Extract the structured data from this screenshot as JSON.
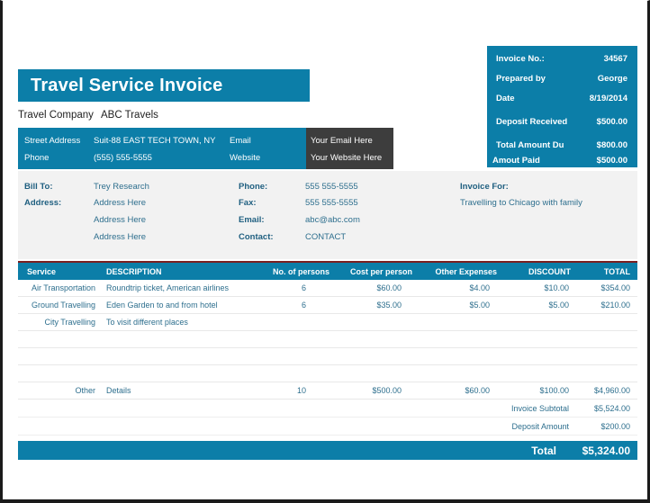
{
  "document": {
    "title": "Travel Service Invoice"
  },
  "company": {
    "label": "Travel Company",
    "name": "ABC Travels"
  },
  "address_strip": {
    "street_label": "Street Address",
    "street_value": "Suit-88 EAST TECH TOWN, NY",
    "phone_label": "Phone",
    "phone_value": "(555) 555-5555",
    "email_label": "Email",
    "email_value": "Your Email Here",
    "website_label": "Website",
    "website_value": "Your Website Here"
  },
  "invoice_box": {
    "rows": [
      {
        "key": "Invoice No.:",
        "value": "34567"
      },
      {
        "key": "Prepared by",
        "value": "George"
      },
      {
        "key": "Date",
        "value": "8/19/2014"
      },
      {
        "key": "Deposit Received",
        "value": "$500.00"
      },
      {
        "key": "Total Amount Du",
        "value": "$800.00"
      },
      {
        "key": "Amout Paid",
        "value": "$500.00"
      }
    ]
  },
  "bill_to": {
    "bill_to_label": "Bill To:",
    "bill_to_value": "Trey Research",
    "address_label": "Address:",
    "address_line1": "Address Here",
    "address_line2": "Address Here",
    "address_line3": "Address Here",
    "phone_label": "Phone:",
    "phone_value": "555 555-5555",
    "fax_label": "Fax:",
    "fax_value": "555 555-5555",
    "email_label": "Email:",
    "email_value": "abc@abc.com",
    "contact_label": "Contact:",
    "contact_value": "CONTACT",
    "invoice_for_label": "Invoice For:",
    "invoice_for_value": "Travelling to Chicago with family"
  },
  "items_table": {
    "headers": {
      "service": "Service",
      "description": "DESCRIPTION",
      "persons": "No. of persons",
      "cost": "Cost per person",
      "other": "Other Expenses",
      "discount": "DISCOUNT",
      "total": "TOTAL"
    },
    "rows": [
      {
        "service": "Air Transportation",
        "description": "Roundtrip ticket, American airlines",
        "persons": "6",
        "cost": "$60.00",
        "other": "$4.00",
        "discount": "$10.00",
        "total": "$354.00"
      },
      {
        "service": "Ground Travelling",
        "description": "Eden Garden to and from hotel",
        "persons": "6",
        "cost": "$35.00",
        "other": "$5.00",
        "discount": "$5.00",
        "total": "$210.00"
      },
      {
        "service": "City Travelling",
        "description": "To visit different places",
        "persons": "",
        "cost": "",
        "other": "",
        "discount": "",
        "total": ""
      },
      {
        "service": "",
        "description": "",
        "persons": "",
        "cost": "",
        "other": "",
        "discount": "",
        "total": ""
      },
      {
        "service": "",
        "description": "",
        "persons": "",
        "cost": "",
        "other": "",
        "discount": "",
        "total": ""
      },
      {
        "service": "",
        "description": "",
        "persons": "",
        "cost": "",
        "other": "",
        "discount": "",
        "total": ""
      },
      {
        "service": "Other",
        "description": "Details",
        "persons": "10",
        "cost": "$500.00",
        "other": "$60.00",
        "discount": "$100.00",
        "total": "$4,960.00"
      }
    ],
    "summary": [
      {
        "label": "Invoice Subtotal",
        "value": "$5,524.00"
      },
      {
        "label": "Deposit Amount",
        "value": "$200.00"
      }
    ],
    "total": {
      "label": "Total",
      "value": "$5,324.00"
    }
  },
  "colors": {
    "brand_teal": "#0c7ea8",
    "dark_block": "#3d3d3d",
    "panel_grey": "#f2f2f2",
    "link_blue": "#2e6f8e"
  }
}
